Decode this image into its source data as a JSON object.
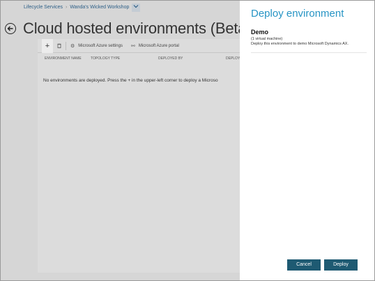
{
  "breadcrumb": {
    "root": "Lifecycle Services",
    "separator": "›",
    "project": "Wanda's Wicked Workshop",
    "dropdown_icon": "chevron-down-icon"
  },
  "page": {
    "title": "Cloud hosted environments (Beta)"
  },
  "toolbar": {
    "add_icon": "+",
    "delete_icon": "🗑",
    "settings_icon": "⚙",
    "settings_label": "Microsoft Azure settings",
    "portal_icon": "⚯",
    "portal_label": "Microsoft Azure portal"
  },
  "table": {
    "columns": [
      "ENVIRONMENT NAME",
      "TOPOLOGY TYPE",
      "DEPLOYED BY",
      "DEPLOY"
    ],
    "empty_message": "No environments are deployed. Press the + in the upper-left corner to deploy a Microso"
  },
  "flyout": {
    "title": "Deploy environment",
    "option": {
      "name": "Demo",
      "subtitle": "(1 virtual machine)",
      "description": "Deploy this environment to demo Microsoft Dynamics AX."
    },
    "cancel_label": "Cancel",
    "deploy_label": "Deploy"
  },
  "colors": {
    "accent": "#2794c4",
    "button_bg": "#1e5a72",
    "link": "#2c5e86",
    "overlay": "#d6d6d6"
  }
}
